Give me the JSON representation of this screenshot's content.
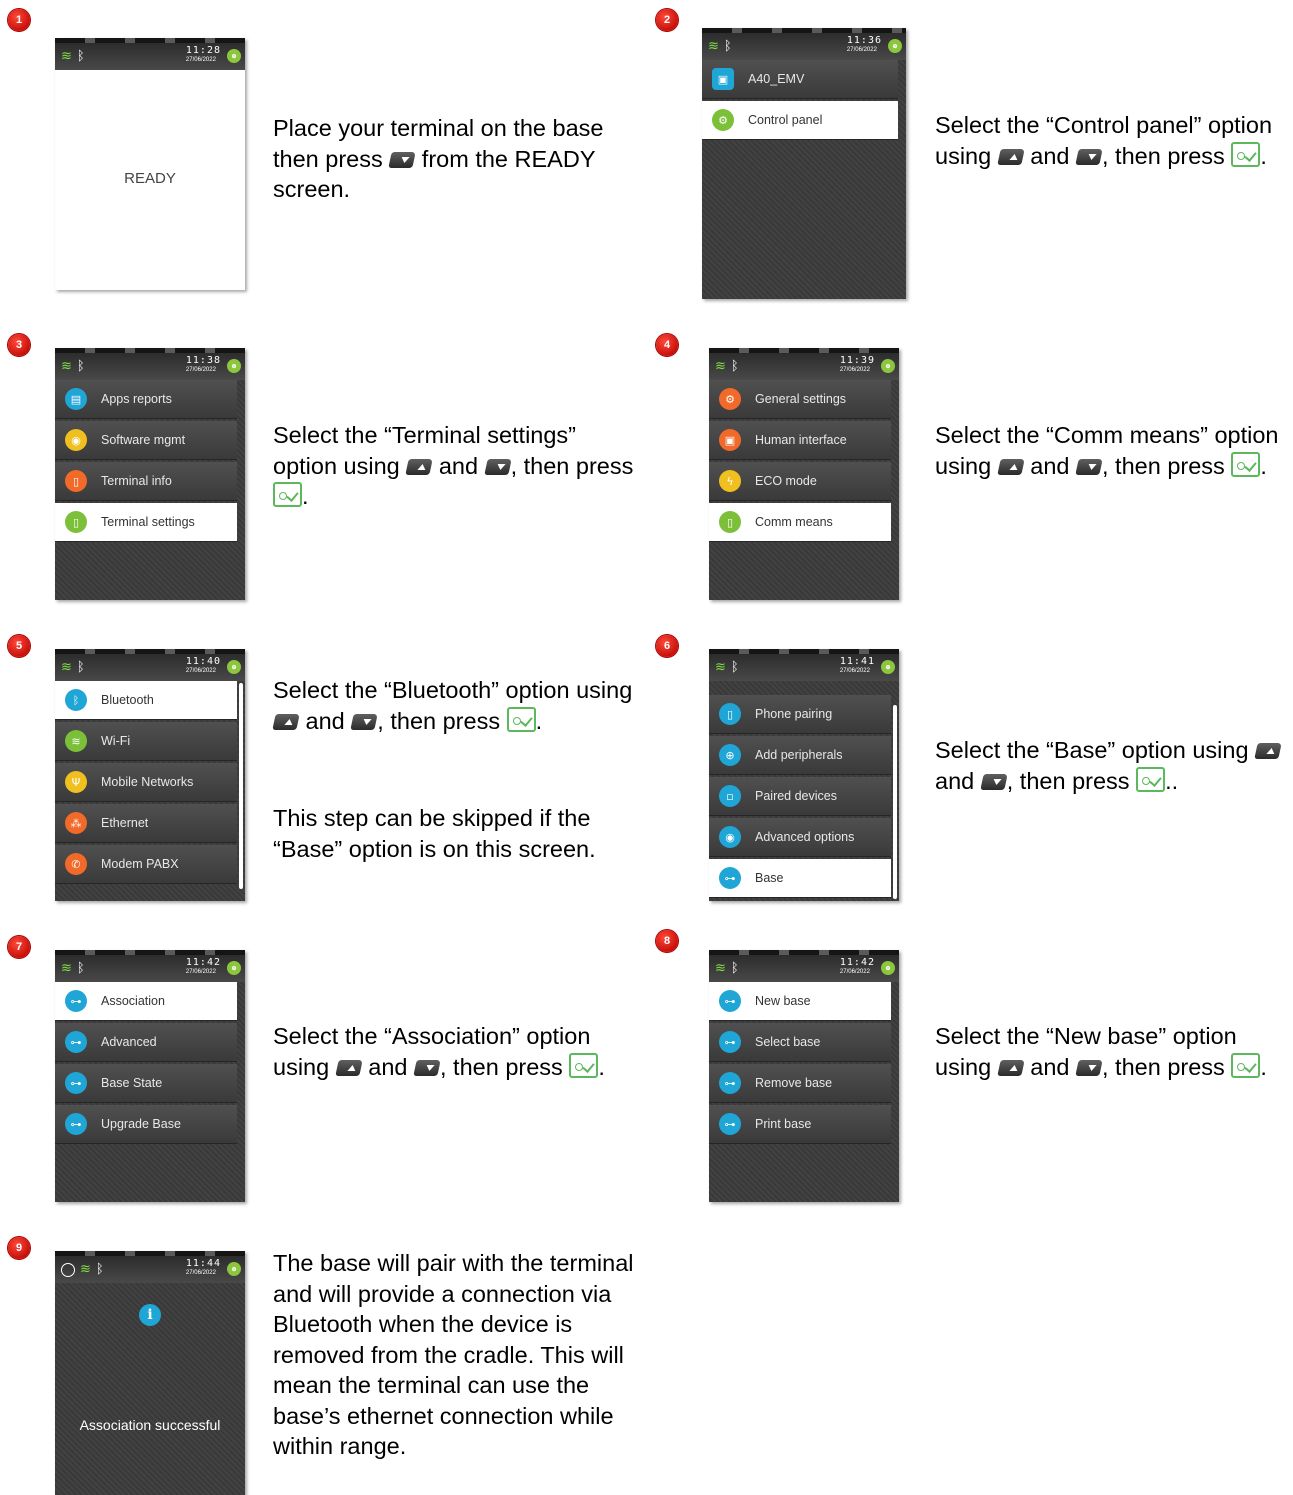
{
  "status": {
    "s1": {
      "time": "11:28",
      "date": "27/06/2022"
    },
    "s2": {
      "time": "11:36",
      "date": "27/06/2022"
    },
    "s3": {
      "time": "11:38",
      "date": "27/06/2022"
    },
    "s4": {
      "time": "11:39",
      "date": "27/06/2022"
    },
    "s5": {
      "time": "11:40",
      "date": "27/06/2022"
    },
    "s6": {
      "time": "11:41",
      "date": "27/06/2022"
    },
    "s7": {
      "time": "11:42",
      "date": "27/06/2022"
    },
    "s8": {
      "time": "11:42",
      "date": "27/06/2022"
    },
    "s9": {
      "time": "11:44",
      "date": "27/06/2022"
    }
  },
  "battery_label": "⊕",
  "steps": [
    {
      "num": "1",
      "screen_text": "READY",
      "desc": {
        "a": "Place your terminal on the base then press",
        "b": "from the READY screen."
      }
    },
    {
      "num": "2",
      "items": [
        "A40_EMV",
        "Control panel"
      ],
      "desc": {
        "a": "Select the “Control panel” option using",
        "b": "and",
        "c": ", then press",
        "d": "."
      }
    },
    {
      "num": "3",
      "items": [
        "Apps reports",
        "Software mgmt",
        "Terminal info",
        "Terminal settings"
      ],
      "desc": {
        "a": "Select the “Terminal settings” option using",
        "b": "and",
        "c": ", then press",
        "d": "."
      }
    },
    {
      "num": "4",
      "items": [
        "General settings",
        "Human interface",
        "ECO mode",
        "Comm means"
      ],
      "desc": {
        "a": "Select the “Comm means” option using",
        "b": "and",
        "c": ", then press",
        "d": "."
      }
    },
    {
      "num": "5",
      "items": [
        "Bluetooth",
        "Wi-Fi",
        "Mobile Networks",
        "Ethernet",
        "Modem PABX"
      ],
      "desc": {
        "a": "Select the “Bluetooth” option using",
        "b": "and",
        "c": ", then press",
        "d": ".",
        "e": "This step can be skipped if the “Base” option is on this screen."
      }
    },
    {
      "num": "6",
      "items": [
        "Phone pairing",
        "Add peripherals",
        "Paired devices",
        "Advanced options",
        "Base"
      ],
      "desc": {
        "a": "Select the “Base” option using",
        "b": "and",
        "c": ", then press",
        "d": ".."
      }
    },
    {
      "num": "7",
      "items": [
        "Association",
        "Advanced",
        "Base State",
        "Upgrade Base"
      ],
      "desc": {
        "a": "Select the “Association” option using",
        "b": "and",
        "c": ", then press",
        "d": "."
      }
    },
    {
      "num": "8",
      "items": [
        "New base",
        "Select base",
        "Remove base",
        "Print base"
      ],
      "desc": {
        "a": "Select the “New base” option using",
        "b": "and",
        "c": ", then press",
        "d": "."
      }
    },
    {
      "num": "9",
      "screen_text": "Association successful",
      "info_icon": "i",
      "desc": {
        "a": "The base will pair with the terminal and will provide a connection via Bluetooth when the device is removed from the cradle. This will mean the terminal can use the base’s ethernet connection while within range."
      }
    }
  ],
  "icons": {
    "wifi": "wifi-icon",
    "bluetooth": "bluetooth-icon",
    "up_key": "up-arrow-key-icon",
    "down_key": "down-arrow-key-icon",
    "ok_key": "validate-key-icon"
  },
  "colors": {
    "badge": "#d0140c",
    "selected_row": "#ffffff",
    "menu_bg": "#3b3b3b",
    "status_icon": "#7ee040",
    "ok_key": "#5cb85c"
  }
}
